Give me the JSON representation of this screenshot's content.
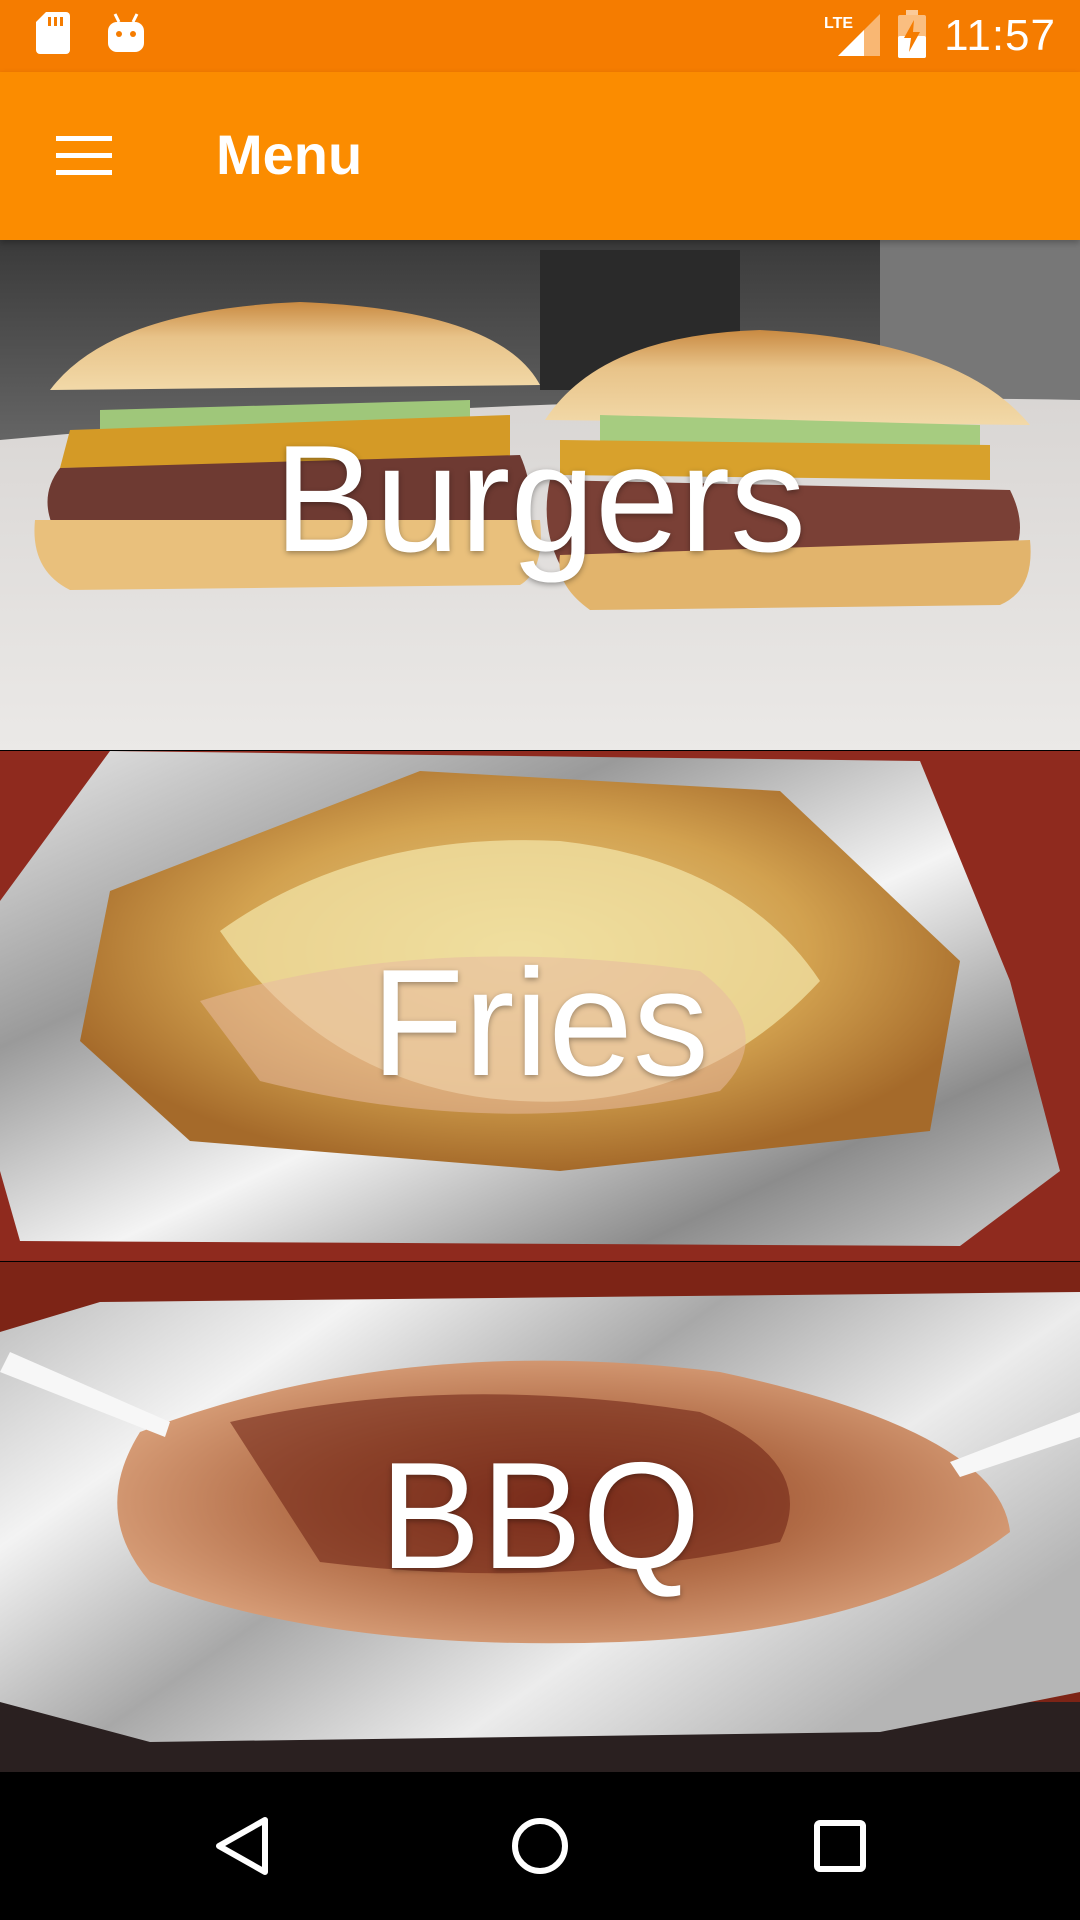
{
  "status_bar": {
    "time": "11:57",
    "network": "LTE",
    "icons": [
      "sd-card-icon",
      "android-debug-icon",
      "lte-signal-icon",
      "battery-charging-icon"
    ]
  },
  "app_bar": {
    "title": "Menu",
    "nav_icon": "hamburger-menu-icon"
  },
  "categories": [
    {
      "label": "Burgers"
    },
    {
      "label": "Fries"
    },
    {
      "label": "BBQ"
    }
  ],
  "nav_bar": {
    "icons": [
      "back-icon",
      "home-icon",
      "recents-icon"
    ]
  },
  "colors": {
    "status_bar": "#f57c00",
    "app_bar": "#fb8c00",
    "text": "#ffffff"
  }
}
